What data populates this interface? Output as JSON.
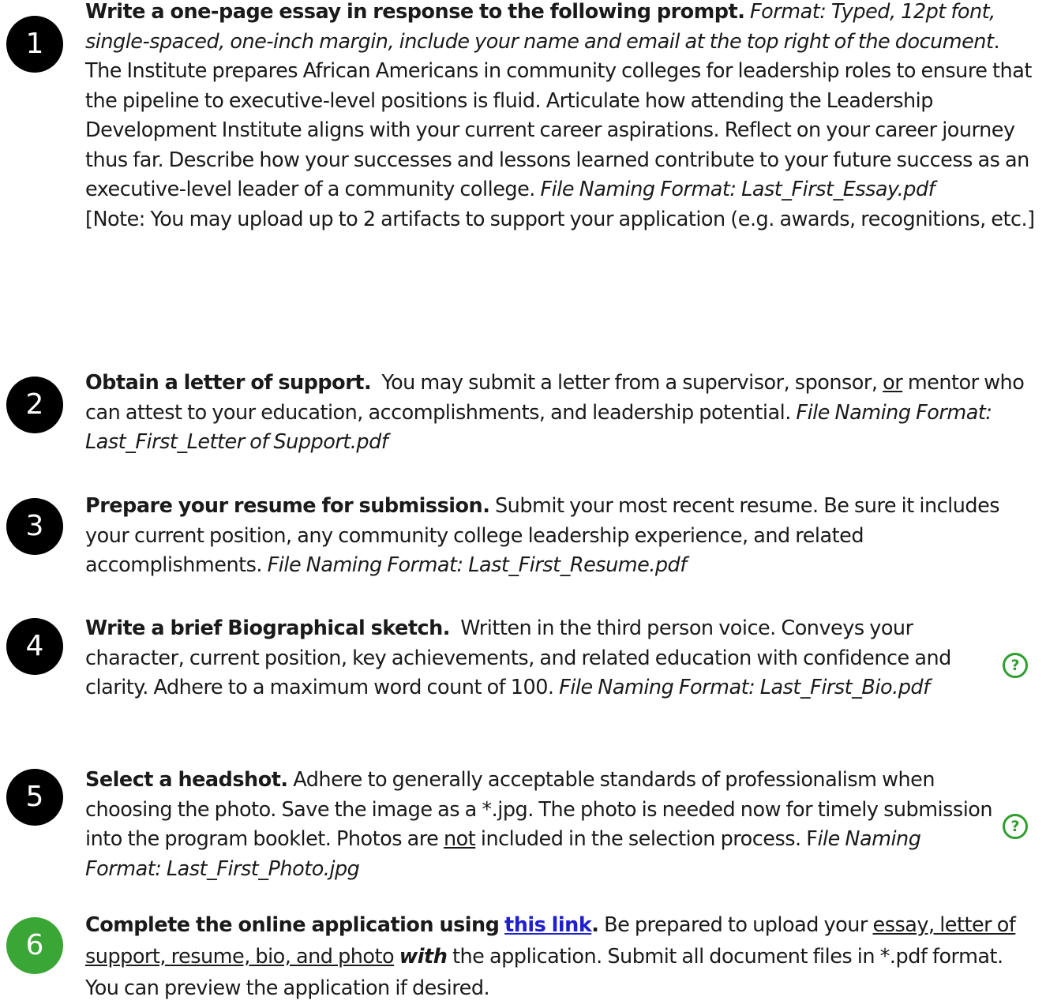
{
  "steps": [
    {
      "number": "1",
      "heading": "Write a one-page essay in response to the following prompt.",
      "format_note": "Format: Typed, 12pt font, single-spaced, one-inch margin, include your name and email at the top right of the document",
      "format_end": ".",
      "body": "The Institute prepares African Americans in community colleges for leadership roles to ensure that the pipeline to executive-level positions is fluid. Articulate how attending the Leadership Development Institute aligns with your current career aspirations. Reflect on your career journey thus far. Describe how your successes and lessons learned contribute to your future success as an executive-level leader of a community college.",
      "file_format": "File Naming Format: Last_First_Essay.pdf",
      "note": "[Note: You may upload up to 2 artifacts to support your application (e.g. awards, recognitions, etc.]"
    },
    {
      "number": "2",
      "heading": "Obtain a letter of support.",
      "body_a": "You may submit a letter from a supervisor, sponsor,",
      "body_or": "or",
      "body_b": "mentor who can attest to your education, accomplishments, and leadership potential.",
      "file_format": "File Naming Format: Last_First_Letter of Support.pdf"
    },
    {
      "number": "3",
      "heading": "Prepare your resume for submission.",
      "body": "Submit your most recent resume. Be sure it includes your current position, any community college leadership experience, and related accomplishments.",
      "file_format": "File Naming Format: Last_First_Resume.pdf"
    },
    {
      "number": "4",
      "heading": "Write a brief Biographical sketch.",
      "body": "Written in the third person voice. Conveys your character, current position, key achievements, and related education with confidence and clarity. Adhere to a maximum word count of 100.",
      "file_format": "File Naming Format: Last_First_Bio.pdf",
      "help_icon": "?"
    },
    {
      "number": "5",
      "heading": "Select a headshot.",
      "body_a": "Adhere to generally acceptable standards of professionalism when choosing the photo. Save the image as a *.jpg. The photo is needed now for timely submission into the program booklet. Photos are",
      "body_not": "not",
      "body_b": "included in the selection process. F",
      "file_format": "ile Naming Format: Last_First_Photo.jpg",
      "help_icon": "?"
    },
    {
      "number": "6",
      "heading": "Complete the online application using",
      "link_text": "this link",
      "heading_end": ".",
      "body_a": "Be prepared to upload your",
      "body_docs": "essay, letter of support, resume, bio, and photo",
      "body_with": "with",
      "body_b": "the application. Submit all document files in *.pdf format.  You can preview the application if desired."
    }
  ],
  "colors": {
    "badge_dark": "#000000",
    "badge_green": "#3aa635",
    "help_green": "#2e9e2e",
    "link_blue": "#1f1fcc"
  }
}
